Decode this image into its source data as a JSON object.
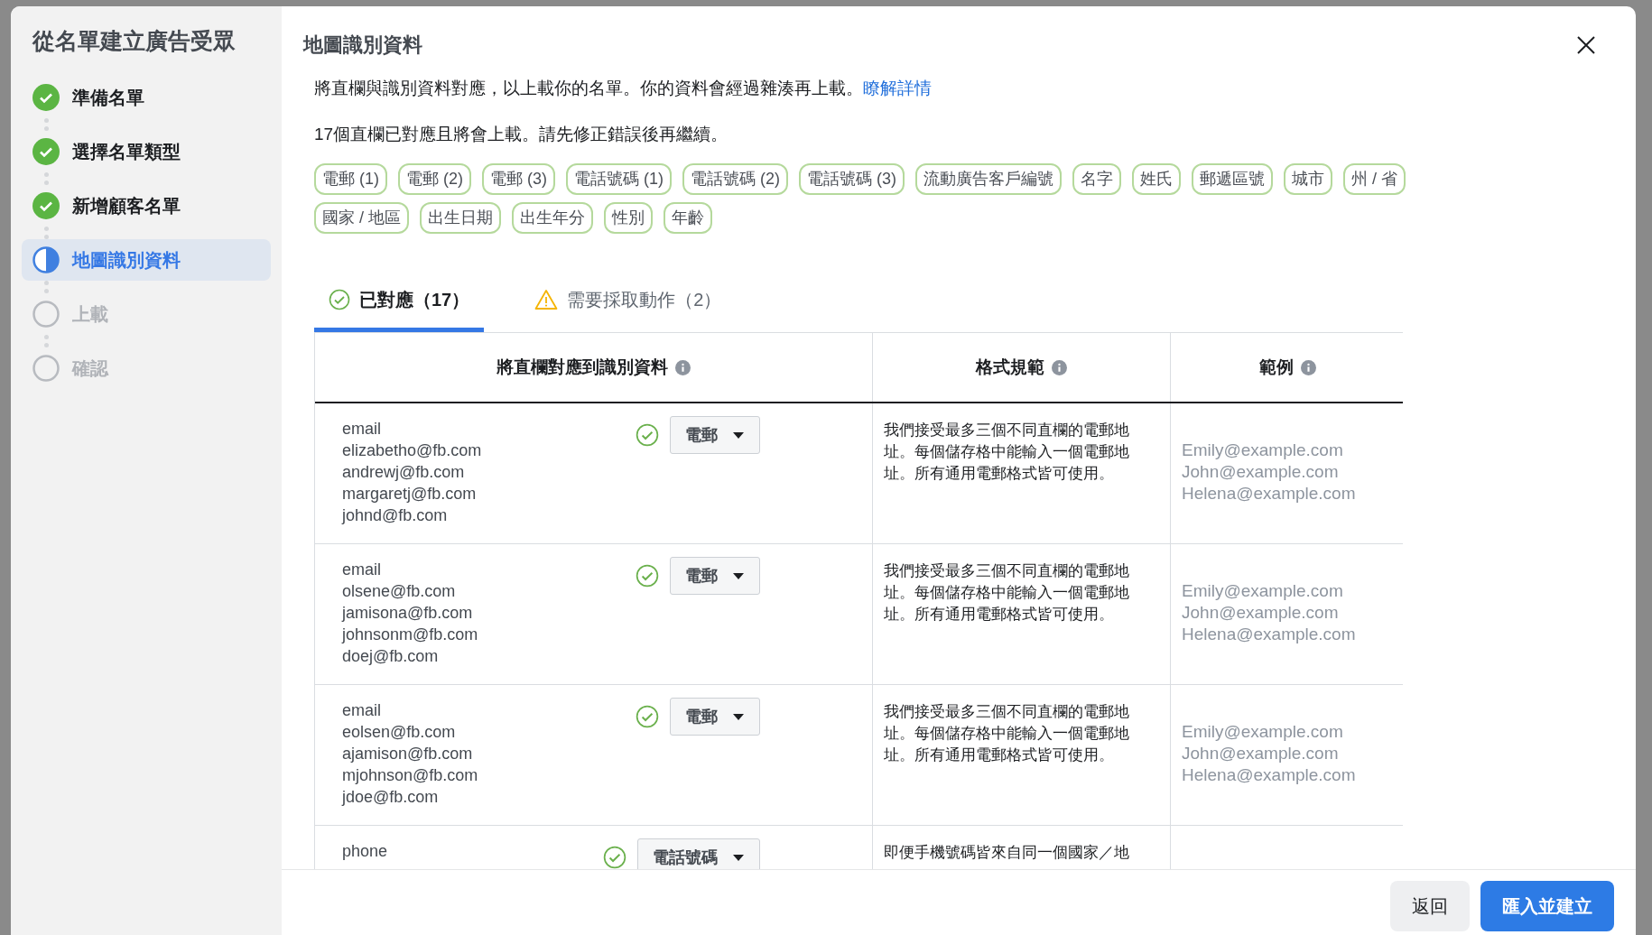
{
  "sidebar": {
    "title": "從名單建立廣告受眾",
    "steps": [
      {
        "label": "準備名單",
        "kind": "done"
      },
      {
        "label": "選擇名單類型",
        "kind": "done"
      },
      {
        "label": "新增顧客名單",
        "kind": "done"
      },
      {
        "label": "地圖識別資料",
        "kind": "current"
      },
      {
        "label": "上載",
        "kind": "pending"
      },
      {
        "label": "確認",
        "kind": "pending"
      }
    ]
  },
  "header": {
    "title": "地圖識別資料"
  },
  "intro": {
    "text": "將直欄與識別資料對應，以上載你的名單。你的資料會經過雜湊再上載。",
    "link": "瞭解詳情"
  },
  "summary": "17個直欄已對應且將會上載。請先修正錯誤後再繼續。",
  "tags": [
    "電郵 (1)",
    "電郵 (2)",
    "電郵 (3)",
    "電話號碼 (1)",
    "電話號碼 (2)",
    "電話號碼 (3)",
    "流動廣告客戶編號",
    "名字",
    "姓氏",
    "郵遞區號",
    "城市",
    "州 / 省",
    "國家 / 地區",
    "出生日期",
    "出生年分",
    "性別",
    "年齡"
  ],
  "tabs": [
    {
      "label": "已對應（17）",
      "kind": "ok",
      "selected": true
    },
    {
      "label": "需要採取動作（2）",
      "kind": "warning",
      "selected": false
    }
  ],
  "table": {
    "columns": [
      "將直欄對應到識別資料",
      "格式規範",
      "範例"
    ],
    "rows": [
      {
        "column_values": [
          "email",
          "elizabetho@fb.com",
          "andrewj@fb.com",
          "margaretj@fb.com",
          "johnd@fb.com"
        ],
        "mapping": "電郵",
        "rule": "我們接受最多三個不同直欄的電郵地址。每個儲存格中能輸入一個電郵地址。所有通用電郵格式皆可使用。",
        "examples": [
          "Emily@example.com",
          "John@example.com",
          "Helena@example.com"
        ]
      },
      {
        "column_values": [
          "email",
          "olsene@fb.com",
          "jamisona@fb.com",
          "johnsonm@fb.com",
          "doej@fb.com"
        ],
        "mapping": "電郵",
        "rule": "我們接受最多三個不同直欄的電郵地址。每個儲存格中能輸入一個電郵地址。所有通用電郵格式皆可使用。",
        "examples": [
          "Emily@example.com",
          "John@example.com",
          "Helena@example.com"
        ]
      },
      {
        "column_values": [
          "email",
          "eolsen@fb.com",
          "ajamison@fb.com",
          "mjohnson@fb.com",
          "jdoe@fb.com"
        ],
        "mapping": "電郵",
        "rule": "我們接受最多三個不同直欄的電郵地址。每個儲存格中能輸入一個電郵地址。所有通用電郵格式皆可使用。",
        "examples": [
          "Emily@example.com",
          "John@example.com",
          "Helena@example.com"
        ]
      },
      {
        "column_values": [
          "phone"
        ],
        "mapping": "電話號碼",
        "rule": "即便手機號碼皆來自同一個國家／地",
        "examples": []
      }
    ]
  },
  "footer": {
    "buttons": [
      {
        "label": "返回",
        "kind": "secondary"
      },
      {
        "label": "匯入並建立",
        "kind": "primary"
      }
    ]
  }
}
